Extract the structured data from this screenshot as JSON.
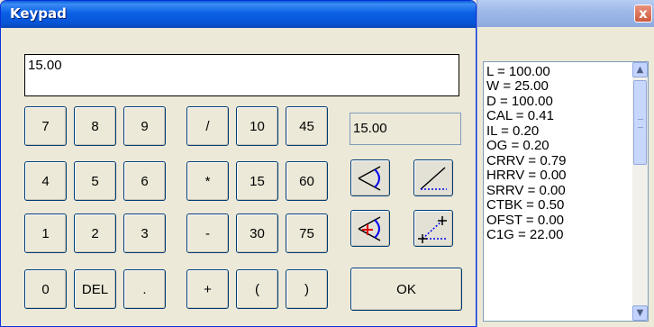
{
  "keypad": {
    "title": "Keypad",
    "display_value": "15.00",
    "result_value": "15.00",
    "ok_label": "OK",
    "digits": {
      "seven": "7",
      "eight": "8",
      "nine": "9",
      "four": "4",
      "five": "5",
      "six": "6",
      "one": "1",
      "two": "2",
      "three": "3",
      "zero": "0",
      "del": "DEL",
      "dot": "."
    },
    "ops": {
      "divide": "/",
      "multiply": "*",
      "minus": "-",
      "plus": "+",
      "lparen": "(",
      "rparen": ")"
    },
    "presets": {
      "p10": "10",
      "p45": "45",
      "p15": "15",
      "p60": "60",
      "p30": "30",
      "p75": "75"
    },
    "icons": [
      "angle-arc-icon",
      "angle-line-icon",
      "angle-arc-plus-icon",
      "angle-line-plus-icon"
    ]
  },
  "info": {
    "close_label": "x",
    "rows": [
      "L  =  100.00",
      "W  =  25.00",
      "D  =  100.00",
      "CAL  =  0.41",
      "IL  =  0.20",
      "OG  =  0.20",
      "CRRV  =  0.79",
      "HRRV  =  0.00",
      "SRRV  =  0.00",
      "CTBK  =  0.50",
      "OFST  =  0.00",
      "C1G  =  22.00"
    ]
  }
}
